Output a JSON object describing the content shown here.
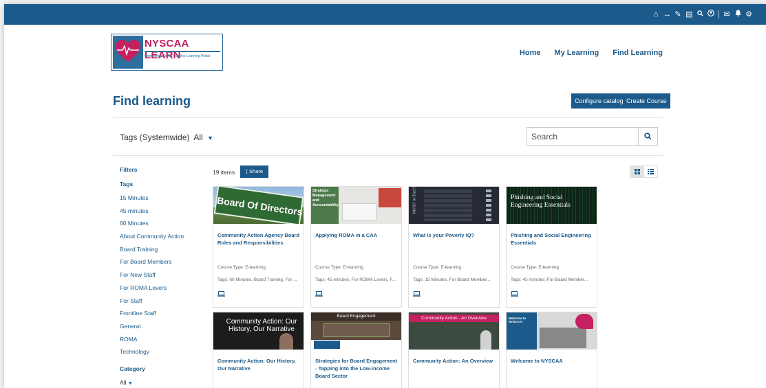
{
  "topbar": {
    "icons": [
      "home-icon",
      "arrows-h-icon",
      "pencil-icon",
      "language-icon",
      "search-icon",
      "user-circle-icon",
      "envelope-icon",
      "bell-icon",
      "gear-icon"
    ]
  },
  "logo": {
    "name": "NYSCAA LEARN",
    "tagline": "Community Action's Online Learning Portal"
  },
  "nav": {
    "home": "Home",
    "my_learning": "My Learning",
    "find_learning": "Find Learning"
  },
  "page": {
    "title": "Find learning",
    "configure_catalog": "Configure catalog",
    "create_course": "Create Course"
  },
  "tags_dropdown": {
    "label": "Tags (Systemwide)",
    "value": "All"
  },
  "search": {
    "placeholder": "Search"
  },
  "filters": {
    "heading": "Filters",
    "tags_heading": "Tags",
    "tags": [
      "15 Minutes",
      "45 minutes",
      "60 Minutes",
      "About Community Action",
      "Board Training",
      "For Board Members",
      "For New Staff",
      "For ROMA Lovers",
      "For Staff",
      "Frontline Staff",
      "General",
      "ROMA",
      "Technology"
    ],
    "category_heading": "Category",
    "category_value": "All"
  },
  "results": {
    "count": "19 items",
    "share": "Share"
  },
  "cards": [
    {
      "title": "Community Action Agency Board Roles and Responsibilities",
      "course_type": "Course Type: E-learning",
      "tags": "Tags: 60 Minutes, Board Training, For ...",
      "image_text": "Board Of Directors"
    },
    {
      "title": "Applying ROMA in a CAA",
      "course_type": "Course Type: E-learning",
      "tags": "Tags: 45 minutes, For ROMA Lovers, F...",
      "image_text": "Strategic Management and Accountability"
    },
    {
      "title": "What is your Poverty IQ?",
      "course_type": "Course Type: E-learning",
      "tags": "Tags: 15 Minutes, For Board Member...",
      "image_text": "Myth? or Fact?"
    },
    {
      "title": "Phishing and Social Engineering Essentials",
      "course_type": "Course Type: E-learning",
      "tags": "Tags: 45 minutes, For Board Member...",
      "image_text": "Phishing and Social Engineering Essentials"
    },
    {
      "title": "Community Action: Our History, Our Narrative",
      "image_text": "Community Action: Our History, Our Narrative"
    },
    {
      "title": "Strategies for Board Engagement - Tapping into the Low-income Board Sector",
      "image_text": "Board Engagement"
    },
    {
      "title": "Community Action: An Overview",
      "image_text": "Community Action - An Overview"
    },
    {
      "title": "Welcome to NYSCAA",
      "image_text": "Welcome to NYSCAA!"
    }
  ],
  "colors": {
    "brand_blue": "#1b5a8a",
    "brand_pink": "#c52060"
  }
}
